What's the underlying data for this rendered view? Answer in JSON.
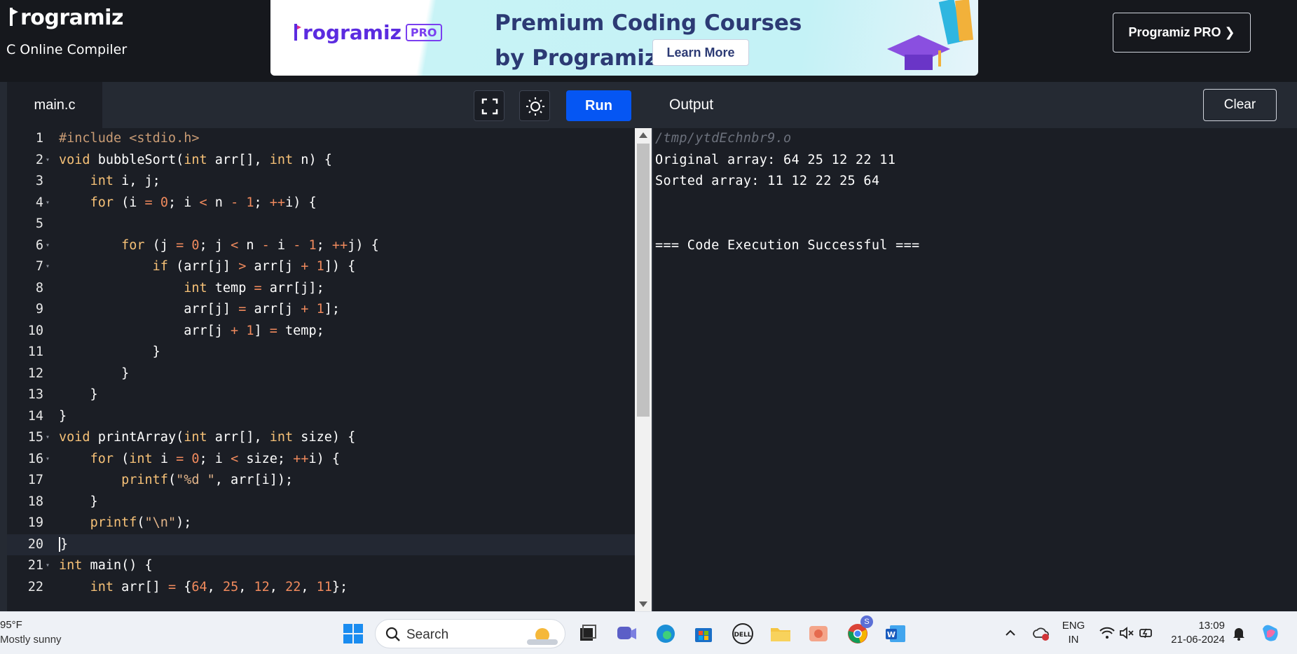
{
  "header": {
    "logo_text": "rogramiz",
    "subtitle": "C Online Compiler",
    "pro_button": "Programiz PRO ❯"
  },
  "banner": {
    "logo_text": "rogramiz",
    "pro_tag": "PRO",
    "title_line1": "Premium Coding Courses",
    "title_line2": "by Programiz",
    "cta": "Learn More"
  },
  "editor": {
    "tab": "main.c",
    "run_label": "Run",
    "fullscreen_icon": "fullscreen-icon",
    "theme_icon": "sun-icon",
    "active_line": 20,
    "lines": [
      {
        "n": "1",
        "fold": false,
        "html": "<span class=\"pp\">#include &lt;stdio.h&gt;</span>"
      },
      {
        "n": "2",
        "fold": true,
        "html": "<span class=\"kw\">void</span> bubbleSort(<span class=\"kw\">int</span> arr[], <span class=\"kw\">int</span> n) {"
      },
      {
        "n": "3",
        "fold": false,
        "html": "    <span class=\"kw\">int</span> i, j;"
      },
      {
        "n": "4",
        "fold": true,
        "html": "    <span class=\"kw\">for</span> (i <span class=\"op\">=</span> <span class=\"num\">0</span>; i <span class=\"op\">&lt;</span> n <span class=\"op\">-</span> <span class=\"num\">1</span>; <span class=\"op\">++</span>i) {"
      },
      {
        "n": "5",
        "fold": false,
        "html": ""
      },
      {
        "n": "6",
        "fold": true,
        "html": "        <span class=\"kw\">for</span> (j <span class=\"op\">=</span> <span class=\"num\">0</span>; j <span class=\"op\">&lt;</span> n <span class=\"op\">-</span> i <span class=\"op\">-</span> <span class=\"num\">1</span>; <span class=\"op\">++</span>j) {"
      },
      {
        "n": "7",
        "fold": true,
        "html": "            <span class=\"kw\">if</span> (arr[j] <span class=\"op\">&gt;</span> arr[j <span class=\"op\">+</span> <span class=\"num\">1</span>]) {"
      },
      {
        "n": "8",
        "fold": false,
        "html": "                <span class=\"kw\">int</span> temp <span class=\"op\">=</span> arr[j];"
      },
      {
        "n": "9",
        "fold": false,
        "html": "                arr[j] <span class=\"op\">=</span> arr[j <span class=\"op\">+</span> <span class=\"num\">1</span>];"
      },
      {
        "n": "10",
        "fold": false,
        "html": "                arr[j <span class=\"op\">+</span> <span class=\"num\">1</span>] <span class=\"op\">=</span> temp;"
      },
      {
        "n": "11",
        "fold": false,
        "html": "            }"
      },
      {
        "n": "12",
        "fold": false,
        "html": "        }"
      },
      {
        "n": "13",
        "fold": false,
        "html": "    }"
      },
      {
        "n": "14",
        "fold": false,
        "html": "}"
      },
      {
        "n": "15",
        "fold": true,
        "html": "<span class=\"kw\">void</span> printArray(<span class=\"kw\">int</span> arr[], <span class=\"kw\">int</span> size) {"
      },
      {
        "n": "16",
        "fold": true,
        "html": "    <span class=\"kw\">for</span> (<span class=\"kw\">int</span> i <span class=\"op\">=</span> <span class=\"num\">0</span>; i <span class=\"op\">&lt;</span> size; <span class=\"op\">++</span>i) {"
      },
      {
        "n": "17",
        "fold": false,
        "html": "        <span class=\"kw\">printf</span>(<span class=\"str\">\"%d \"</span>, arr[i]);"
      },
      {
        "n": "18",
        "fold": false,
        "html": "    }"
      },
      {
        "n": "19",
        "fold": false,
        "html": "    <span class=\"kw\">printf</span>(<span class=\"str\">\"\\n\"</span>);"
      },
      {
        "n": "20",
        "fold": false,
        "html": "<span class=\"cursor\">}</span>"
      },
      {
        "n": "21",
        "fold": true,
        "html": "<span class=\"kw\">int</span> main() {"
      },
      {
        "n": "22",
        "fold": false,
        "html": "    <span class=\"kw\">int</span> arr[] <span class=\"op\">=</span> {<span class=\"num\">64</span>, <span class=\"num\">25</span>, <span class=\"num\">12</span>, <span class=\"num\">22</span>, <span class=\"num\">11</span>};"
      }
    ]
  },
  "output": {
    "title": "Output",
    "clear_label": "Clear",
    "lines": [
      {
        "text": "/tmp/ytdEchnbr9.o",
        "dim": true
      },
      {
        "text": "Original array: 64 25 12 22 11",
        "dim": false
      },
      {
        "text": "Sorted array: 11 12 22 25 64",
        "dim": false
      },
      {
        "text": "",
        "dim": false
      },
      {
        "text": "",
        "dim": false
      },
      {
        "text": "=== Code Execution Successful ===",
        "dim": false
      }
    ]
  },
  "taskbar": {
    "weather_temp": "95°F",
    "weather_desc": "Mostly sunny",
    "search_label": "Search",
    "lang_line1": "ENG",
    "lang_line2": "IN",
    "time": "13:09",
    "date": "21-06-2024",
    "chrome_badge": "S",
    "apps": [
      "windows-start-icon",
      "task-view-icon",
      "teams-chat-icon",
      "edge-browser-icon",
      "microsoft-store-icon",
      "dell-icon",
      "file-explorer-icon",
      "photo-app-icon",
      "chrome-icon",
      "word-icon"
    ]
  },
  "colors": {
    "run_button": "#0556f3",
    "editor_bg": "#1b1e25",
    "header_bg": "#252a33",
    "keyword": "#f6c177",
    "number": "#f08a5d"
  }
}
